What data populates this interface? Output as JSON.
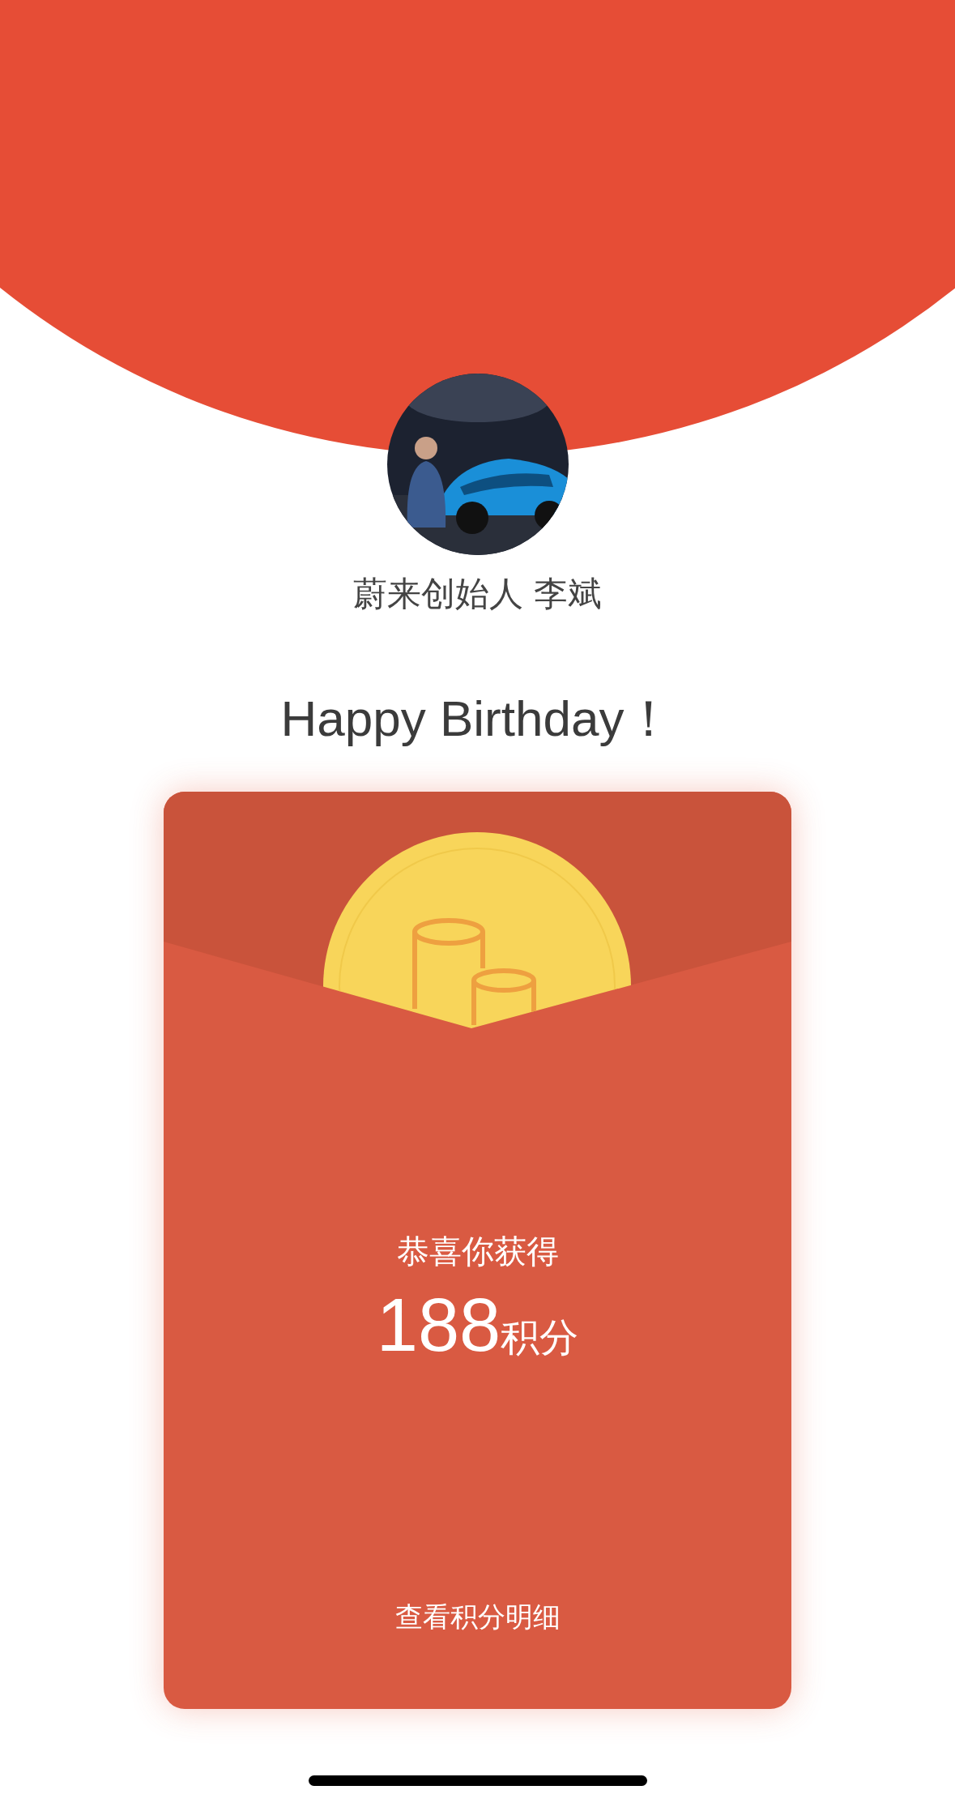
{
  "header": {
    "name": "蔚来创始人 李斌"
  },
  "greeting": "Happy Birthday！",
  "red_packet": {
    "caption": "恭喜你获得",
    "amount": "188",
    "unit": "积分",
    "link": "查看积分明细"
  }
}
